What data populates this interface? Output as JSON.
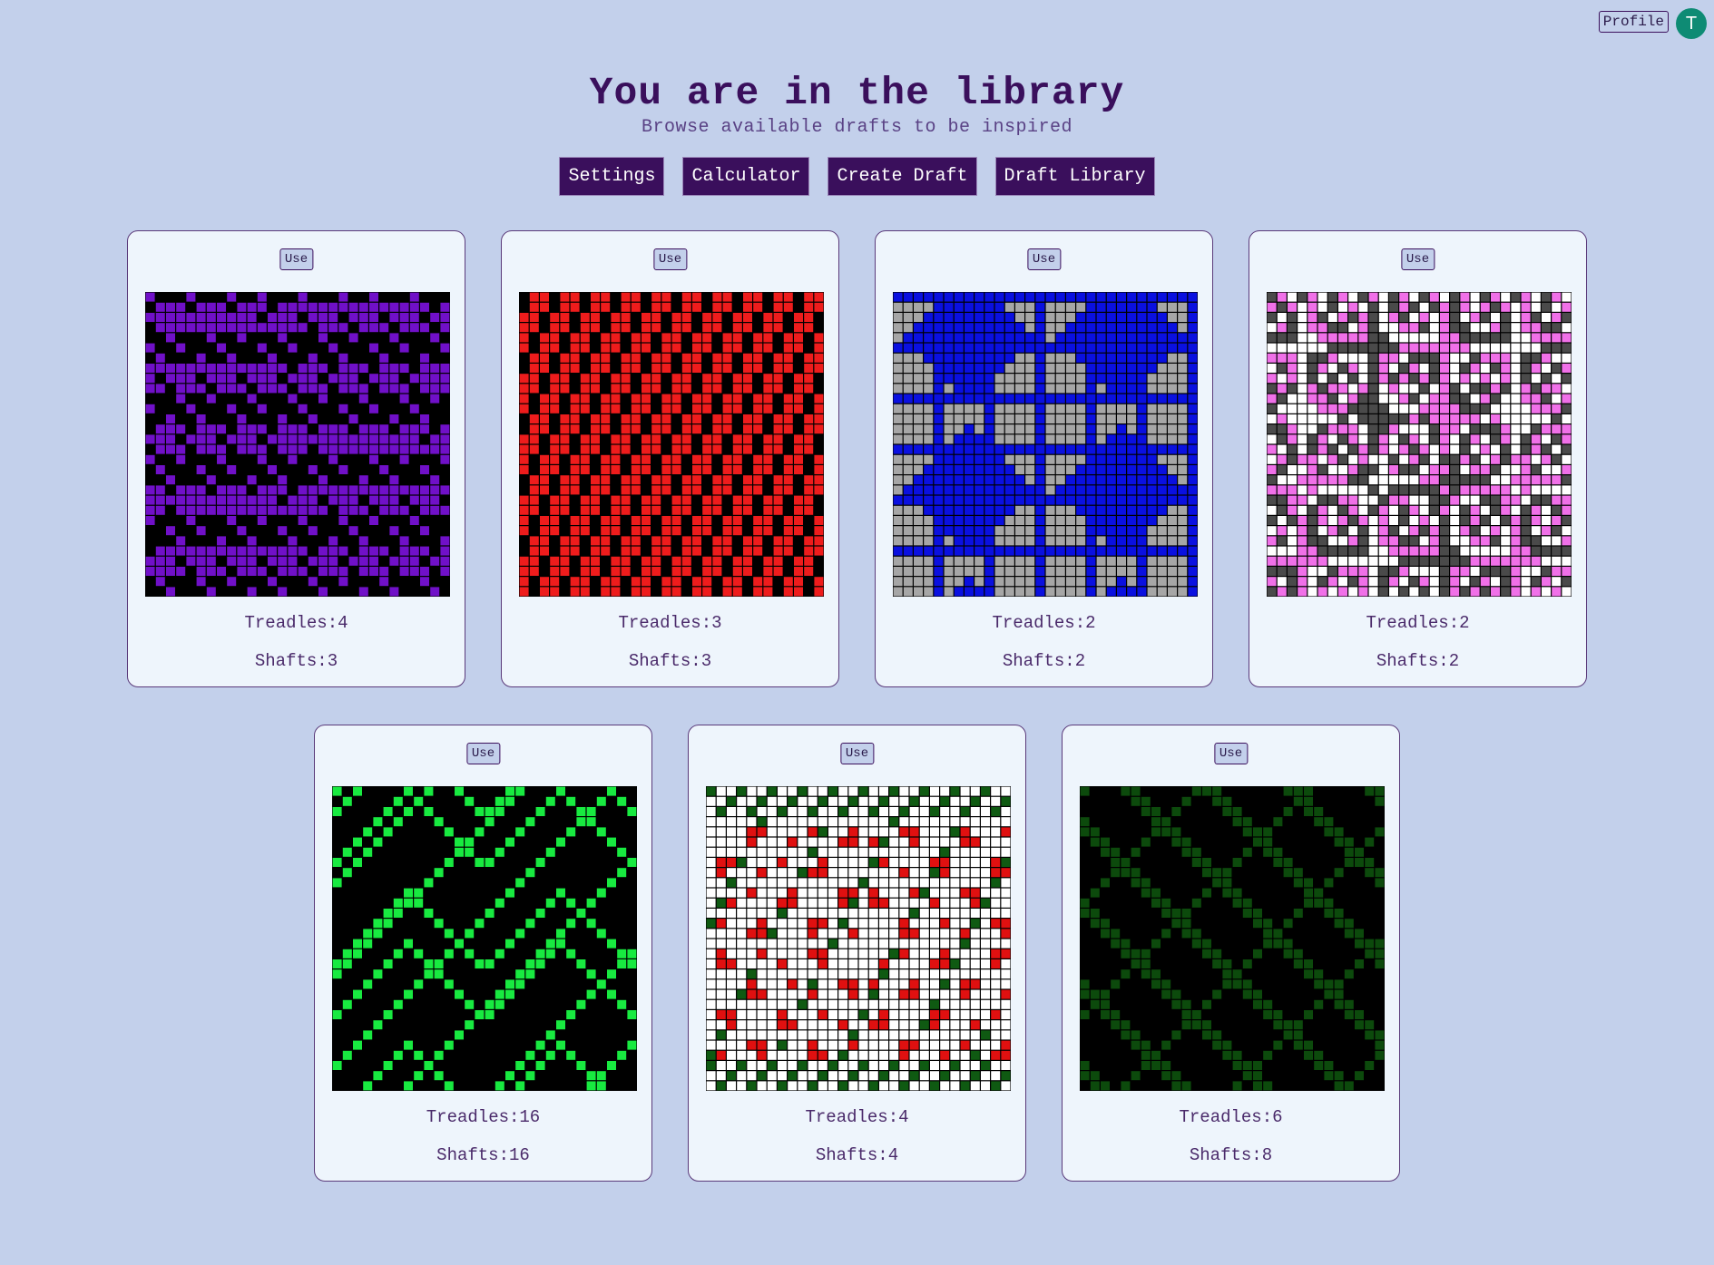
{
  "header": {
    "title": "You are in the library",
    "subtitle": "Browse available drafts to be inspired"
  },
  "topbar": {
    "profile_label": "Profile",
    "avatar_initial": "T"
  },
  "nav": {
    "settings": "Settings",
    "calculator": "Calculator",
    "create_draft": "Create Draft",
    "draft_library": "Draft Library"
  },
  "drafts": [
    {
      "use_label": "Use",
      "treadles_label": "Treadles:",
      "treadles": "4",
      "shafts_label": "Shafts:",
      "shafts": "3",
      "colors": {
        "warp": "#000000",
        "weft": "#7010c8"
      }
    },
    {
      "use_label": "Use",
      "treadles_label": "Treadles:",
      "treadles": "3",
      "shafts_label": "Shafts:",
      "shafts": "3",
      "colors": {
        "warp": "#000000",
        "weft": "#ee1c1c"
      }
    },
    {
      "use_label": "Use",
      "treadles_label": "Treadles:",
      "treadles": "2",
      "shafts_label": "Shafts:",
      "shafts": "2",
      "colors": {
        "warp": "#a6a6a6",
        "weft": "#0a10e0"
      }
    },
    {
      "use_label": "Use",
      "treadles_label": "Treadles:",
      "treadles": "2",
      "shafts_label": "Shafts:",
      "shafts": "2",
      "colors": {
        "warp": "#4a4a4a",
        "weft": "#f070e8",
        "alt": "#ffffff"
      }
    },
    {
      "use_label": "Use",
      "treadles_label": "Treadles:",
      "treadles": "16",
      "shafts_label": "Shafts:",
      "shafts": "16",
      "colors": {
        "warp": "#000000",
        "weft": "#18ea40"
      }
    },
    {
      "use_label": "Use",
      "treadles_label": "Treadles:",
      "treadles": "4",
      "shafts_label": "Shafts:",
      "shafts": "4",
      "colors": {
        "warp": "#ffffff",
        "weft": "#e01010",
        "alt": "#0f5a12"
      }
    },
    {
      "use_label": "Use",
      "treadles_label": "Treadles:",
      "treadles": "6",
      "shafts_label": "Shafts:",
      "shafts": "8",
      "colors": {
        "warp": "#000000",
        "weft": "#0c4a0c"
      }
    }
  ]
}
